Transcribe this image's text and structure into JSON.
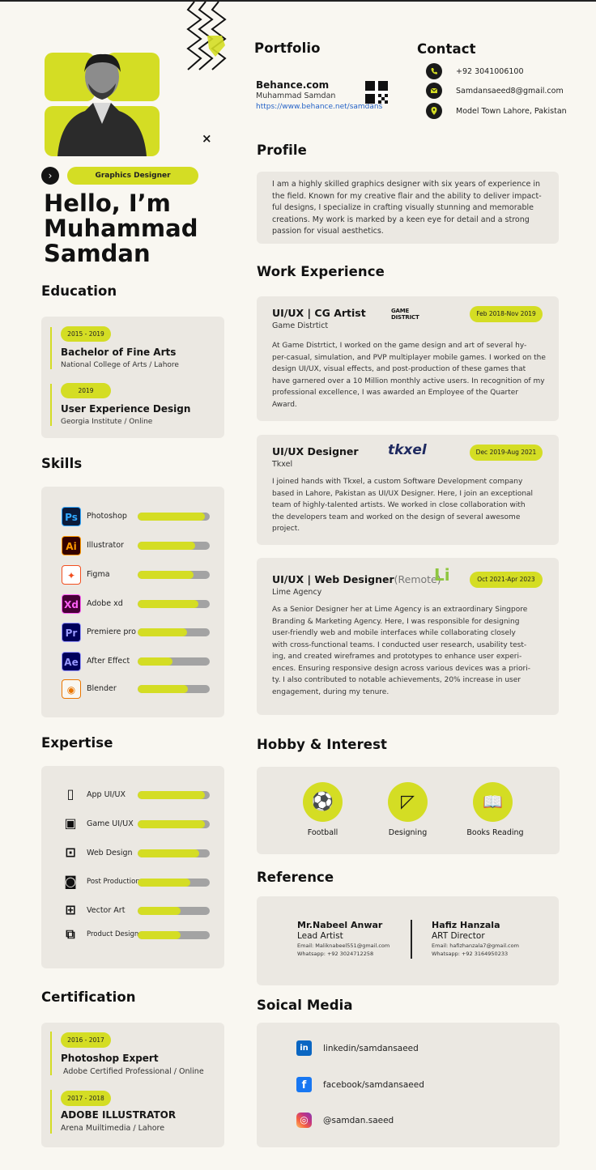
{
  "colors": {
    "accent": "#d4dd24",
    "card": "#ebe8e2",
    "bg": "#f9f7f1",
    "text": "#161616",
    "bar_track": "#a3a3a3"
  },
  "header": {
    "badge": "Graphics Designer",
    "hello_line1": "Hello, I’m",
    "hello_line2": "Muhammad",
    "hello_line3": "Samdan",
    "arrow_icon": "chevron-right-icon",
    "close_mark": "×"
  },
  "portfolio": {
    "title": "Portfolio",
    "site": "Behance.com",
    "name": "Muhammad Samdan",
    "url": "https://www.behance.net/samdans"
  },
  "contact": {
    "title": "Contact",
    "phone": "+92 3041006100",
    "email": "Samdansaeed8@gmail.com",
    "address": "Model Town Lahore, Pakistan"
  },
  "profile": {
    "title": "Profile",
    "lines": [
      "I am a highly skilled graphics designer with six years of experience in",
      "the field. Known for my creative flair and the ability to deliver impact-",
      "ful designs, I specialize in crafting visually stunning and memorable",
      "creations. My work is marked by a keen eye for detail and a strong",
      "passion for visual aesthetics."
    ]
  },
  "education": {
    "title": "Education",
    "items": [
      {
        "years": "2015 - 2019",
        "degree": "Bachelor of Fine Arts",
        "school": "National College of Arts / Lahore"
      },
      {
        "years": "2019",
        "degree": "User Experience Design",
        "school": "Georgia Institute / Online"
      }
    ]
  },
  "skills": {
    "title": "Skills",
    "items": [
      {
        "abbr": "Ps",
        "name": "Photoshop",
        "level": 0.93,
        "icon": "photoshop-icon",
        "bg": "#0a1a3a",
        "fg": "#31a8ff"
      },
      {
        "abbr": "Ai",
        "name": "Illustrator",
        "level": 0.8,
        "icon": "illustrator-icon",
        "bg": "#330000",
        "fg": "#ff9a00"
      },
      {
        "abbr": "✦",
        "name": "Figma",
        "level": 0.78,
        "icon": "figma-icon",
        "bg": "#ffffff",
        "fg": "#f24e1e"
      },
      {
        "abbr": "Xd",
        "name": "Adobe xd",
        "level": 0.84,
        "icon": "adobe-xd-icon",
        "bg": "#470137",
        "fg": "#ff61f6"
      },
      {
        "abbr": "Pr",
        "name": "Premiere pro",
        "level": 0.68,
        "icon": "premiere-pro-icon",
        "bg": "#00005b",
        "fg": "#9999ff"
      },
      {
        "abbr": "Ae",
        "name": "After Effect",
        "level": 0.48,
        "icon": "after-effects-icon",
        "bg": "#00005b",
        "fg": "#9999ff"
      },
      {
        "abbr": "◉",
        "name": "Blender",
        "level": 0.7,
        "icon": "blender-icon",
        "bg": "#f9f7f1",
        "fg": "#ea7600"
      }
    ]
  },
  "expertise": {
    "title": "Expertise",
    "items": [
      {
        "name": "App UI/UX",
        "level": 0.93,
        "glyph": "▯",
        "icon": "mobile-app-icon"
      },
      {
        "name": "Game UI/UX",
        "level": 0.93,
        "glyph": "▣",
        "icon": "game-icon"
      },
      {
        "name": "Web Design",
        "level": 0.85,
        "glyph": "⊡",
        "icon": "web-design-icon"
      },
      {
        "name": "Post Production",
        "level": 0.73,
        "glyph": "◙",
        "icon": "post-production-icon"
      },
      {
        "name": "Vector Art",
        "level": 0.6,
        "glyph": "⊞",
        "icon": "vector-art-icon"
      },
      {
        "name": "Product Design",
        "level": 0.6,
        "glyph": "⧉",
        "icon": "product-design-icon"
      }
    ]
  },
  "certification": {
    "title": "Certification",
    "items": [
      {
        "years": "2016 - 2017",
        "name": "Photoshop Expert",
        "org": "Adobe Certified Professional / Online"
      },
      {
        "years": "2017 - 2018",
        "name": "ADOBE ILLUSTRATOR",
        "org": "Arena Muiltimedia / Lahore"
      }
    ]
  },
  "work": {
    "title": "Work Experience",
    "jobs": [
      {
        "role": "UI/UX | CG Artist",
        "company": "Game Distrtict",
        "logo": "GAME DISTRICT",
        "dates": "Feb 2018-Nov 2019",
        "lines": [
          "At Game Distrtict, I worked on the game design and art of several hy-",
          "per-casual, simulation, and PVP multiplayer mobile games. I worked on the",
          "design UI/UX, visual effects, and post-production of these games that",
          "have garnered over a 10 Million monthly active users. In recognition of my",
          "professional excellence, I was awarded an Employee of the Quarter",
          "Award."
        ]
      },
      {
        "role": "UI/UX Designer",
        "company": "Tkxel",
        "logo": "tkxel",
        "dates": "Dec 2019-Aug 2021",
        "lines": [
          "I joined hands with Tkxel, a custom Software Development company",
          "based in Lahore, Pakistan as UI/UX Designer. Here, I join an exceptional",
          "team of highly-talented artists. We worked in close collaboration with",
          "the developers team and worked on the design of several awesome",
          "project."
        ]
      },
      {
        "role": "UI/UX | Web Designer",
        "remote": "(Remote)",
        "company": "Lime Agency",
        "logo": "Li",
        "dates": "Oct 2021-Apr 2023",
        "lines": [
          "As a Senior Designer her at Lime Agency is an extraordinary Singpore",
          "Branding & Marketing Agency. Here,  I was responsible for designing",
          "user-friendly web and mobile interfaces while collaborating closely",
          "with cross-functional teams. I conducted user research, usability test-",
          "ing, and created wireframes and prototypes to enhance user experi-",
          "ences. Ensuring responsive design across various devices was a priori-",
          "ty. I also contributed to notable achievements, 20% increase in user",
          "engagement, during my tenure."
        ]
      }
    ]
  },
  "hobby": {
    "title": "Hobby & Interest",
    "items": [
      {
        "name": "Football",
        "glyph": "⚽",
        "icon": "football-icon"
      },
      {
        "name": "Designing",
        "glyph": "◸",
        "icon": "designing-icon"
      },
      {
        "name": "Books Reading",
        "glyph": "📖",
        "icon": "book-icon"
      }
    ]
  },
  "reference": {
    "title": "Reference",
    "people": [
      {
        "name": "Mr.Nabeel Anwar",
        "role": "Lead Artist",
        "email": "Email:  Maliknabeel551@gmail.com",
        "whatsapp": "Whatsapp:  +92 3024712258"
      },
      {
        "name": "Hafiz Hanzala",
        "role": "ART Director",
        "email": "Email:  hafizhanzala7@gmail.com",
        "whatsapp": "Whatsapp:  +92 3164950233"
      }
    ]
  },
  "social": {
    "title": "Soical Media",
    "items": [
      {
        "handle": "linkedin/samdansaeed",
        "abbr": "in",
        "icon": "linkedin-icon",
        "bg": "#0a66c2"
      },
      {
        "handle": "facebook/samdansaeed",
        "abbr": "f",
        "icon": "facebook-icon",
        "bg": "#1877f2"
      },
      {
        "handle": "@samdan.saeed",
        "abbr": "◎",
        "icon": "instagram-icon",
        "bg": "#d6249f"
      }
    ]
  }
}
